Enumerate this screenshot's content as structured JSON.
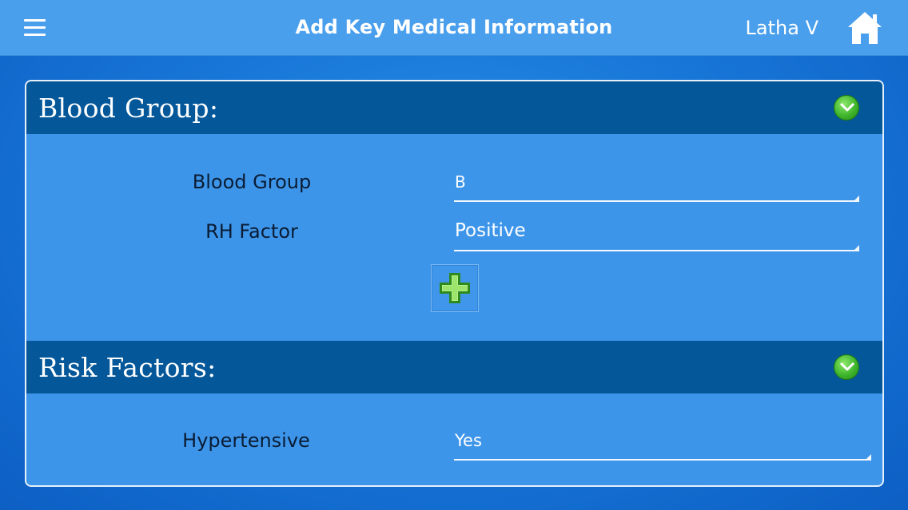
{
  "header": {
    "menu_icon": "hamburger-menu-icon",
    "title": "Add Key Medical Information",
    "user_name": "Latha V",
    "home_icon": "home-icon"
  },
  "sections": [
    {
      "title": "Blood Group:",
      "toggle_icon": "chevron-down-icon",
      "fields": [
        {
          "label": "Blood Group",
          "value": "B"
        },
        {
          "label": "RH Factor",
          "value": "Positive"
        }
      ],
      "add_icon": "plus-icon"
    },
    {
      "title": "Risk Factors:",
      "toggle_icon": "chevron-down-icon",
      "fields": [
        {
          "label": "Hypertensive",
          "value": "Yes"
        }
      ]
    }
  ],
  "colors": {
    "topbar": "#4a9fec",
    "section_header": "#04589a",
    "panel": "#3d95ea",
    "accent_green": "#3fb52c"
  }
}
